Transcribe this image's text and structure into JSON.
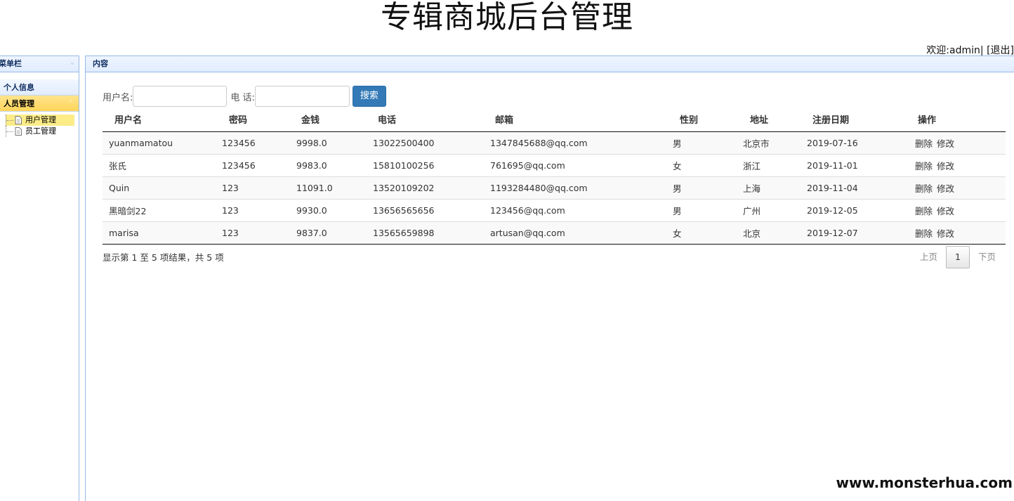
{
  "app": {
    "title": "专辑商城后台管理",
    "welcome": "欢迎:admin|",
    "logout": "[退出]"
  },
  "menu": {
    "title": "菜单栏",
    "sections": [
      {
        "label": "个人信息"
      },
      {
        "label": "人员管理"
      }
    ],
    "tree": [
      {
        "label": "用户管理"
      },
      {
        "label": "员工管理"
      }
    ]
  },
  "content": {
    "title": "内容"
  },
  "search": {
    "username_label": "用户名:",
    "username_value": "",
    "phone_label": "电 话:",
    "phone_value": "",
    "button": "搜索"
  },
  "table": {
    "headers": [
      "用户名",
      "密码",
      "金钱",
      "电话",
      "邮箱",
      "性别",
      "地址",
      "注册日期",
      "操作"
    ],
    "rows": [
      {
        "username": "yuanmamatou",
        "password": "123456",
        "money": "9998.0",
        "phone": "13022500400",
        "email": "1347845688@qq.com",
        "gender": "男",
        "address": "北京市",
        "date": "2019-07-16"
      },
      {
        "username": "张氏",
        "password": "123456",
        "money": "9983.0",
        "phone": "15810100256",
        "email": "761695@qq.com",
        "gender": "女",
        "address": "浙江",
        "date": "2019-11-01"
      },
      {
        "username": "Quin",
        "password": "123",
        "money": "11091.0",
        "phone": "13520109202",
        "email": "1193284480@qq.com",
        "gender": "男",
        "address": "上海",
        "date": "2019-11-04"
      },
      {
        "username": "黑暗剑22",
        "password": "123",
        "money": "9930.0",
        "phone": "13656565656",
        "email": "123456@qq.com",
        "gender": "男",
        "address": "广州",
        "date": "2019-12-05"
      },
      {
        "username": "marisa",
        "password": "123",
        "money": "9837.0",
        "phone": "13565659898",
        "email": "artusan@qq.com",
        "gender": "女",
        "address": "北京",
        "date": "2019-12-07"
      }
    ],
    "delete_label": "删除",
    "edit_label": "修改"
  },
  "footer": {
    "info": "显示第 1 至 5 项结果，共 5 项",
    "prev": "上页",
    "page": "1",
    "next": "下页"
  },
  "watermark": "www.monsterhua.com",
  "colors": {
    "panel_border": "#95b8e7",
    "active_accordion": "#ffd55a",
    "search_button": "#337ab7"
  }
}
